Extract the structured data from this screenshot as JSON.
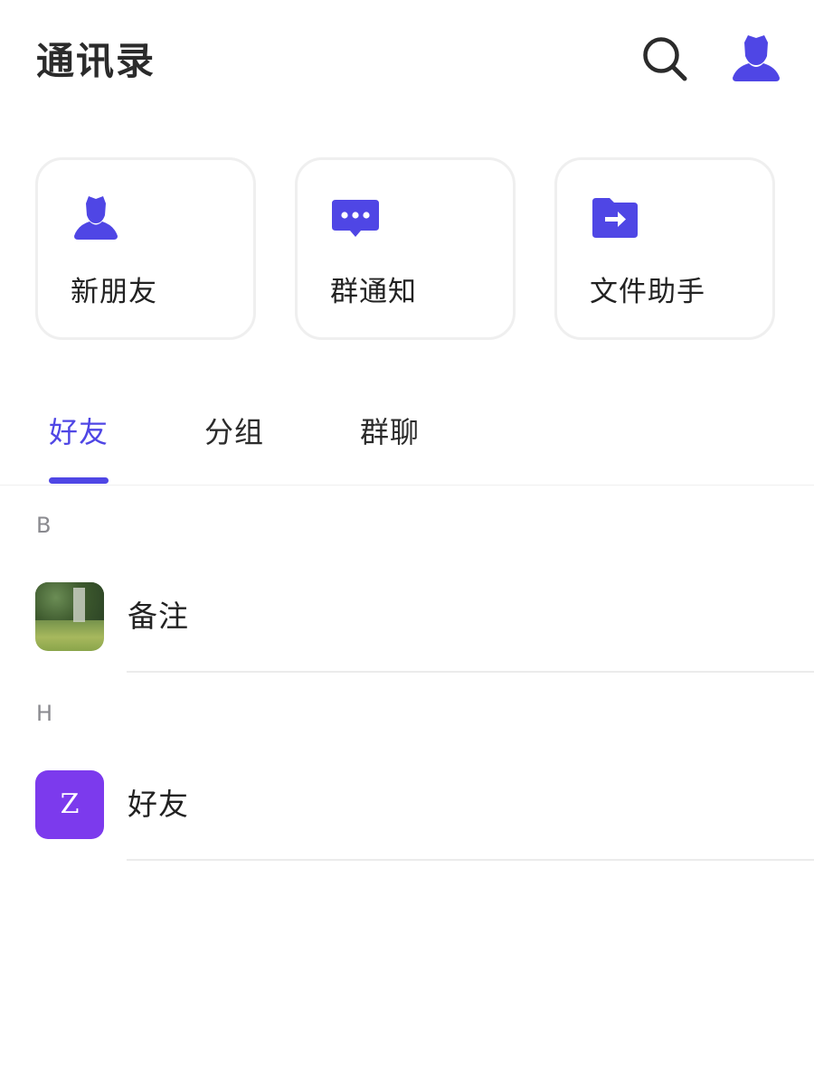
{
  "header": {
    "title": "通讯录",
    "search_icon": "search-icon",
    "profile_icon": "user-icon"
  },
  "quick_actions": [
    {
      "label": "新朋友",
      "icon": "user-icon"
    },
    {
      "label": "群通知",
      "icon": "message-dots-icon"
    },
    {
      "label": "文件助手",
      "icon": "folder-arrow-icon"
    }
  ],
  "tabs": [
    {
      "label": "好友",
      "active": true
    },
    {
      "label": "分组",
      "active": false
    },
    {
      "label": "群聊",
      "active": false
    }
  ],
  "contacts": [
    {
      "section": "B",
      "name": "备注",
      "avatar": "photo"
    },
    {
      "section": "H",
      "name": "好友",
      "avatar_letter": "Z"
    }
  ],
  "colors": {
    "accent": "#4f46e5",
    "avatar_purple": "#7c3aed",
    "text": "#222222",
    "section_text": "#8a8a8f"
  }
}
